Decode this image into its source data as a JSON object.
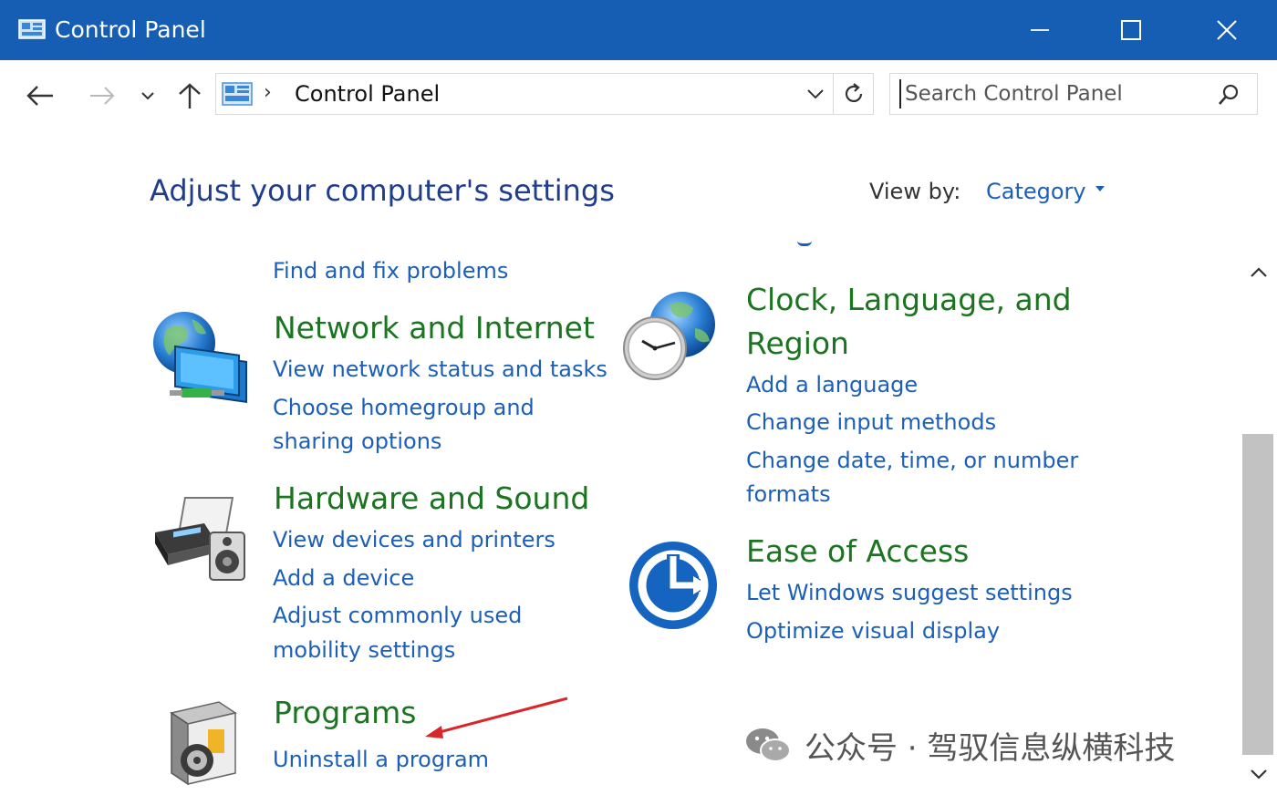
{
  "window": {
    "title": "Control Panel",
    "minimize_icon": "minimize-icon",
    "maximize_icon": "maximize-icon",
    "close_icon": "close-icon",
    "title_bar_color": "#165eb3"
  },
  "nav": {
    "breadcrumb_root": "Control Panel",
    "search_placeholder": "Search Control Panel"
  },
  "header": {
    "title": "Adjust your computer's settings",
    "view_by_label": "View by:",
    "view_by_value": "Category"
  },
  "categories_left": [
    {
      "title": "",
      "links": [
        "Find and fix problems"
      ]
    },
    {
      "title": "Network and Internet",
      "links": [
        "View network status and tasks",
        "Choose homegroup and",
        "sharing options"
      ]
    },
    {
      "title": "Hardware and Sound",
      "links": [
        "View devices and printers",
        "Add a device",
        "Adjust commonly used",
        "mobility settings"
      ]
    },
    {
      "title": "Programs",
      "links": [
        "Uninstall a program"
      ]
    }
  ],
  "categories_right": [
    {
      "title_line1": "Clock, Language, and",
      "title_line2": "Region",
      "links": [
        "Add a language",
        "Change input methods",
        "Change date, time, or number",
        "formats"
      ]
    },
    {
      "title": "Ease of Access",
      "links": [
        "Let Windows suggest settings",
        "Optimize visual display"
      ]
    }
  ],
  "watermark": {
    "text": "公众号 · 驾驭信息纵横科技"
  },
  "colors": {
    "link": "#1c5fb9",
    "category_title": "#1b7420",
    "heading": "#1f3d8c",
    "annotation_arrow": "#d9262b"
  }
}
